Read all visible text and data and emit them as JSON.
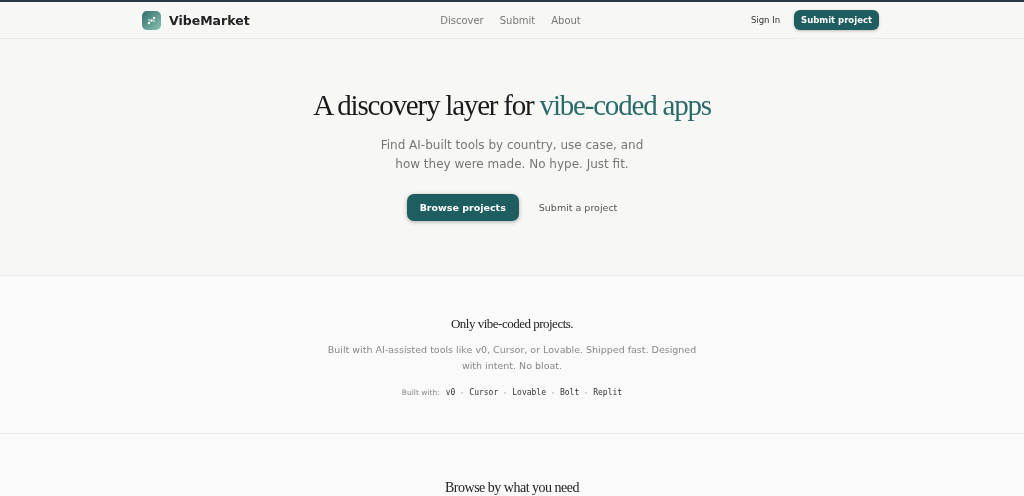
{
  "header": {
    "brand": "VibeMarket",
    "nav": [
      {
        "label": "Discover"
      },
      {
        "label": "Submit"
      },
      {
        "label": "About"
      }
    ],
    "sign_in": "Sign In",
    "submit_button": "Submit project"
  },
  "hero": {
    "title": "A discovery layer for",
    "title_accent": "vibe-coded apps",
    "subtitle": "Find AI-built tools by country, use case, and how they were made. No hype. Just fit.",
    "primary_button": "Browse projects",
    "secondary_link": "Submit a project"
  },
  "about": {
    "heading": "Only vibe-coded projects.",
    "text": "Built with AI-assisted tools like v0, Cursor, or Lovable. Shipped fast. Designed with intent. No bloat.",
    "built_with_label": "Built with:",
    "tools": [
      "v0",
      "Cursor",
      "Lovable",
      "Bolt",
      "Replit"
    ]
  },
  "browse": {
    "heading": "Browse by what you need"
  }
}
